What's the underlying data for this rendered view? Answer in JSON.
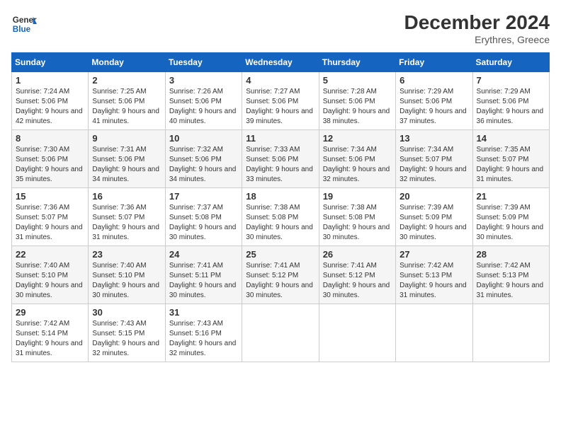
{
  "header": {
    "logo_text_general": "General",
    "logo_text_blue": "Blue",
    "month_year": "December 2024",
    "location": "Erythres, Greece"
  },
  "weekdays": [
    "Sunday",
    "Monday",
    "Tuesday",
    "Wednesday",
    "Thursday",
    "Friday",
    "Saturday"
  ],
  "weeks": [
    [
      {
        "day": 1,
        "sunrise": "7:24 AM",
        "sunset": "5:06 PM",
        "daylight": "9 hours and 42 minutes."
      },
      {
        "day": 2,
        "sunrise": "7:25 AM",
        "sunset": "5:06 PM",
        "daylight": "9 hours and 41 minutes."
      },
      {
        "day": 3,
        "sunrise": "7:26 AM",
        "sunset": "5:06 PM",
        "daylight": "9 hours and 40 minutes."
      },
      {
        "day": 4,
        "sunrise": "7:27 AM",
        "sunset": "5:06 PM",
        "daylight": "9 hours and 39 minutes."
      },
      {
        "day": 5,
        "sunrise": "7:28 AM",
        "sunset": "5:06 PM",
        "daylight": "9 hours and 38 minutes."
      },
      {
        "day": 6,
        "sunrise": "7:29 AM",
        "sunset": "5:06 PM",
        "daylight": "9 hours and 37 minutes."
      },
      {
        "day": 7,
        "sunrise": "7:29 AM",
        "sunset": "5:06 PM",
        "daylight": "9 hours and 36 minutes."
      }
    ],
    [
      {
        "day": 8,
        "sunrise": "7:30 AM",
        "sunset": "5:06 PM",
        "daylight": "9 hours and 35 minutes."
      },
      {
        "day": 9,
        "sunrise": "7:31 AM",
        "sunset": "5:06 PM",
        "daylight": "9 hours and 34 minutes."
      },
      {
        "day": 10,
        "sunrise": "7:32 AM",
        "sunset": "5:06 PM",
        "daylight": "9 hours and 34 minutes."
      },
      {
        "day": 11,
        "sunrise": "7:33 AM",
        "sunset": "5:06 PM",
        "daylight": "9 hours and 33 minutes."
      },
      {
        "day": 12,
        "sunrise": "7:34 AM",
        "sunset": "5:06 PM",
        "daylight": "9 hours and 32 minutes."
      },
      {
        "day": 13,
        "sunrise": "7:34 AM",
        "sunset": "5:07 PM",
        "daylight": "9 hours and 32 minutes."
      },
      {
        "day": 14,
        "sunrise": "7:35 AM",
        "sunset": "5:07 PM",
        "daylight": "9 hours and 31 minutes."
      }
    ],
    [
      {
        "day": 15,
        "sunrise": "7:36 AM",
        "sunset": "5:07 PM",
        "daylight": "9 hours and 31 minutes."
      },
      {
        "day": 16,
        "sunrise": "7:36 AM",
        "sunset": "5:07 PM",
        "daylight": "9 hours and 31 minutes."
      },
      {
        "day": 17,
        "sunrise": "7:37 AM",
        "sunset": "5:08 PM",
        "daylight": "9 hours and 30 minutes."
      },
      {
        "day": 18,
        "sunrise": "7:38 AM",
        "sunset": "5:08 PM",
        "daylight": "9 hours and 30 minutes."
      },
      {
        "day": 19,
        "sunrise": "7:38 AM",
        "sunset": "5:08 PM",
        "daylight": "9 hours and 30 minutes."
      },
      {
        "day": 20,
        "sunrise": "7:39 AM",
        "sunset": "5:09 PM",
        "daylight": "9 hours and 30 minutes."
      },
      {
        "day": 21,
        "sunrise": "7:39 AM",
        "sunset": "5:09 PM",
        "daylight": "9 hours and 30 minutes."
      }
    ],
    [
      {
        "day": 22,
        "sunrise": "7:40 AM",
        "sunset": "5:10 PM",
        "daylight": "9 hours and 30 minutes."
      },
      {
        "day": 23,
        "sunrise": "7:40 AM",
        "sunset": "5:10 PM",
        "daylight": "9 hours and 30 minutes."
      },
      {
        "day": 24,
        "sunrise": "7:41 AM",
        "sunset": "5:11 PM",
        "daylight": "9 hours and 30 minutes."
      },
      {
        "day": 25,
        "sunrise": "7:41 AM",
        "sunset": "5:12 PM",
        "daylight": "9 hours and 30 minutes."
      },
      {
        "day": 26,
        "sunrise": "7:41 AM",
        "sunset": "5:12 PM",
        "daylight": "9 hours and 30 minutes."
      },
      {
        "day": 27,
        "sunrise": "7:42 AM",
        "sunset": "5:13 PM",
        "daylight": "9 hours and 31 minutes."
      },
      {
        "day": 28,
        "sunrise": "7:42 AM",
        "sunset": "5:13 PM",
        "daylight": "9 hours and 31 minutes."
      }
    ],
    [
      {
        "day": 29,
        "sunrise": "7:42 AM",
        "sunset": "5:14 PM",
        "daylight": "9 hours and 31 minutes."
      },
      {
        "day": 30,
        "sunrise": "7:43 AM",
        "sunset": "5:15 PM",
        "daylight": "9 hours and 32 minutes."
      },
      {
        "day": 31,
        "sunrise": "7:43 AM",
        "sunset": "5:16 PM",
        "daylight": "9 hours and 32 minutes."
      },
      null,
      null,
      null,
      null
    ]
  ]
}
